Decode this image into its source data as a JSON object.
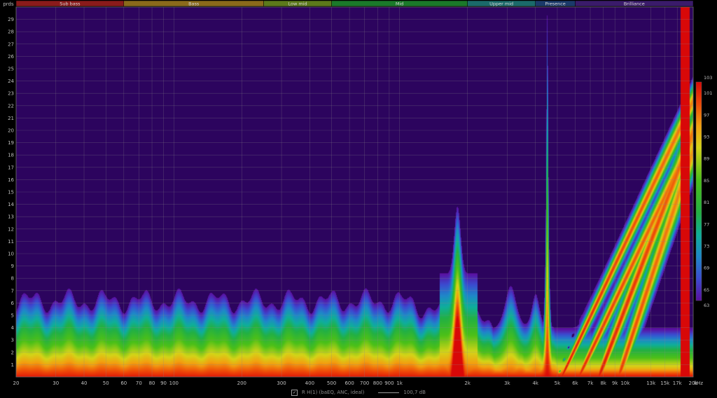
{
  "chart_data": {
    "type": "heatmap",
    "title": "",
    "xlabel": "",
    "ylabel": "prds",
    "x_unit": "kHz",
    "x_scale": "log",
    "xlim": [
      20,
      20000
    ],
    "ylim": [
      0,
      30
    ],
    "grid": true,
    "x_ticks": [
      {
        "value": 20,
        "label": "20"
      },
      {
        "value": 30,
        "label": "30"
      },
      {
        "value": 40,
        "label": "40"
      },
      {
        "value": 50,
        "label": "50"
      },
      {
        "value": 60,
        "label": "60"
      },
      {
        "value": 70,
        "label": "70"
      },
      {
        "value": 80,
        "label": "80"
      },
      {
        "value": 90,
        "label": "90"
      },
      {
        "value": 100,
        "label": "100"
      },
      {
        "value": 200,
        "label": "200"
      },
      {
        "value": 300,
        "label": "300"
      },
      {
        "value": 400,
        "label": "400"
      },
      {
        "value": 500,
        "label": "500"
      },
      {
        "value": 600,
        "label": "600"
      },
      {
        "value": 700,
        "label": "700"
      },
      {
        "value": 800,
        "label": "800"
      },
      {
        "value": 900,
        "label": "900"
      },
      {
        "value": 1000,
        "label": "1k"
      },
      {
        "value": 2000,
        "label": "2k"
      },
      {
        "value": 3000,
        "label": "3k"
      },
      {
        "value": 4000,
        "label": "4k"
      },
      {
        "value": 5000,
        "label": "5k"
      },
      {
        "value": 6000,
        "label": "6k"
      },
      {
        "value": 7000,
        "label": "7k"
      },
      {
        "value": 8000,
        "label": "8k"
      },
      {
        "value": 9000,
        "label": "9k"
      },
      {
        "value": 10000,
        "label": "10k"
      },
      {
        "value": 13000,
        "label": "13k"
      },
      {
        "value": 15000,
        "label": "15k"
      },
      {
        "value": 17000,
        "label": "17k"
      },
      {
        "value": 20000,
        "label": "20k"
      }
    ],
    "y_ticks": [
      1,
      2,
      3,
      4,
      5,
      6,
      7,
      8,
      9,
      10,
      11,
      12,
      13,
      14,
      15,
      16,
      17,
      18,
      19,
      20,
      21,
      22,
      23,
      24,
      25,
      26,
      27,
      28,
      29
    ],
    "colorbar": {
      "min": 63,
      "max": 103,
      "ticks": [
        "103",
        "101",
        "97",
        "93",
        "89",
        "85",
        "81",
        "77",
        "73",
        "69",
        "65",
        "63"
      ],
      "stops": [
        {
          "value": 63,
          "color": "#5a0fa0"
        },
        {
          "value": 67,
          "color": "#3b4bd0"
        },
        {
          "value": 71,
          "color": "#1e88c8"
        },
        {
          "value": 75,
          "color": "#0fae9a"
        },
        {
          "value": 79,
          "color": "#22b044"
        },
        {
          "value": 85,
          "color": "#4cc018"
        },
        {
          "value": 91,
          "color": "#d4d418"
        },
        {
          "value": 95,
          "color": "#f2a010"
        },
        {
          "value": 99,
          "color": "#ee4a08"
        },
        {
          "value": 103,
          "color": "#d80808"
        }
      ]
    },
    "bands": [
      {
        "name": "Sub bass",
        "from": 20,
        "to": 60,
        "color": "#8a1b1b"
      },
      {
        "name": "Bass",
        "from": 60,
        "to": 250,
        "color": "#8a6a1b"
      },
      {
        "name": "Low mid",
        "from": 250,
        "to": 500,
        "color": "#5c7a1b"
      },
      {
        "name": "Mid",
        "from": 500,
        "to": 2000,
        "color": "#1b7a2a"
      },
      {
        "name": "Upper mid",
        "from": 2000,
        "to": 4000,
        "color": "#1b6a6a"
      },
      {
        "name": "Presence",
        "from": 4000,
        "to": 6000,
        "color": "#1b3a6a"
      },
      {
        "name": "Brilliance",
        "from": 6000,
        "to": 20000,
        "color": "#3a1b6a"
      }
    ],
    "plot_background": "#2c045e",
    "series": [
      {
        "name": "R H(1) (baEQ, ANC, ideal)",
        "level": "100,7 dB"
      }
    ]
  },
  "legend": {
    "checked_mark": "✓",
    "series_label": "R H(1) (baEQ, ANC, ideal)",
    "level_label": "100,7 dB"
  }
}
